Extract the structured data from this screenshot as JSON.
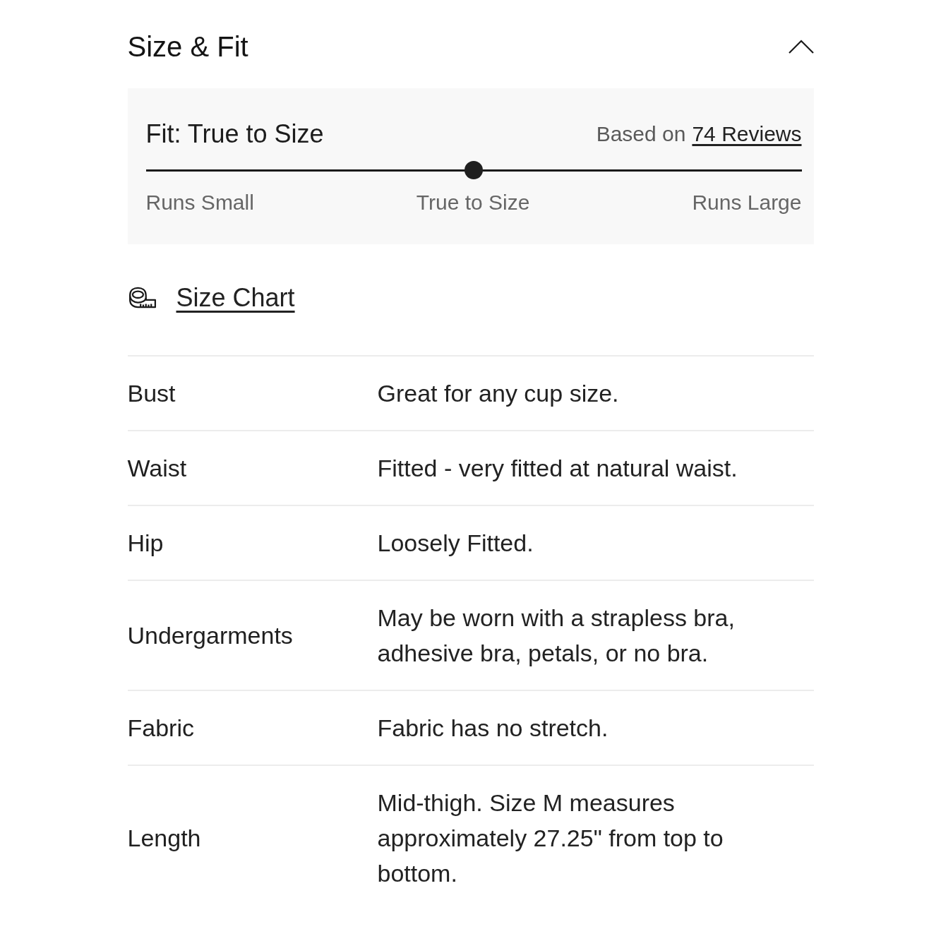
{
  "section": {
    "title": "Size & Fit",
    "expanded": true
  },
  "fit": {
    "heading": "Fit: True to Size",
    "based_on": "Based on",
    "reviews_link": "74 Reviews",
    "level": 0.5,
    "labels": [
      "Runs Small",
      "True to Size",
      "Runs Large"
    ]
  },
  "size_chart": {
    "label": "Size Chart"
  },
  "details": [
    {
      "label": "Bust",
      "value": "Great for any cup size."
    },
    {
      "label": "Waist",
      "value": "Fitted - very fitted at natural waist."
    },
    {
      "label": "Hip",
      "value": "Loosely Fitted."
    },
    {
      "label": "Undergarments",
      "value": "May be worn with a strapless bra, adhesive bra, petals, or no bra."
    },
    {
      "label": "Fabric",
      "value": "Fabric has no stretch."
    },
    {
      "label": "Length",
      "value": "Mid-thigh. Size M measures approximately 27.25\" from top to bottom."
    }
  ]
}
